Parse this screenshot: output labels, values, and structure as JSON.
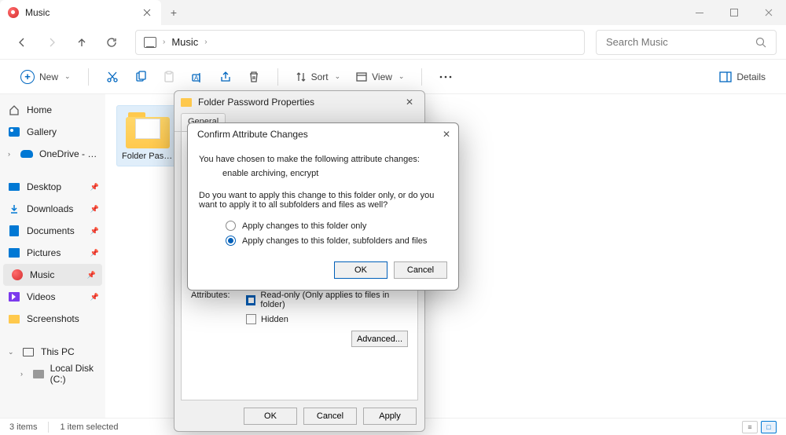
{
  "tab": {
    "title": "Music"
  },
  "address": {
    "crumb": "Music"
  },
  "search": {
    "placeholder": "Search Music"
  },
  "toolbar": {
    "new": "New",
    "sort": "Sort",
    "view": "View",
    "details": "Details"
  },
  "sidebar": {
    "home": "Home",
    "gallery": "Gallery",
    "onedrive": "OneDrive - Perso",
    "desktop": "Desktop",
    "downloads": "Downloads",
    "documents": "Documents",
    "pictures": "Pictures",
    "music": "Music",
    "videos": "Videos",
    "screenshots": "Screenshots",
    "thispc": "This PC",
    "localdisk": "Local Disk (C:)"
  },
  "content": {
    "folder1": "Folder Passw..."
  },
  "statusbar": {
    "items": "3 items",
    "selected": "1 item selected"
  },
  "props": {
    "title": "Folder Password Properties",
    "tabs": {
      "general": "General"
    },
    "attr_label": "Attributes:",
    "readonly": "Read-only (Only applies to files in folder)",
    "hidden": "Hidden",
    "advanced": "Advanced...",
    "ok": "OK",
    "cancel": "Cancel",
    "apply": "Apply"
  },
  "confirm": {
    "title": "Confirm Attribute Changes",
    "line1": "You have chosen to make the following attribute changes:",
    "line2": "enable archiving, encrypt",
    "line3": "Do you want to apply this change to this folder only, or do you want to apply it to all subfolders and files as well?",
    "opt1": "Apply changes to this folder only",
    "opt2": "Apply changes to this folder, subfolders and files",
    "ok": "OK",
    "cancel": "Cancel"
  }
}
